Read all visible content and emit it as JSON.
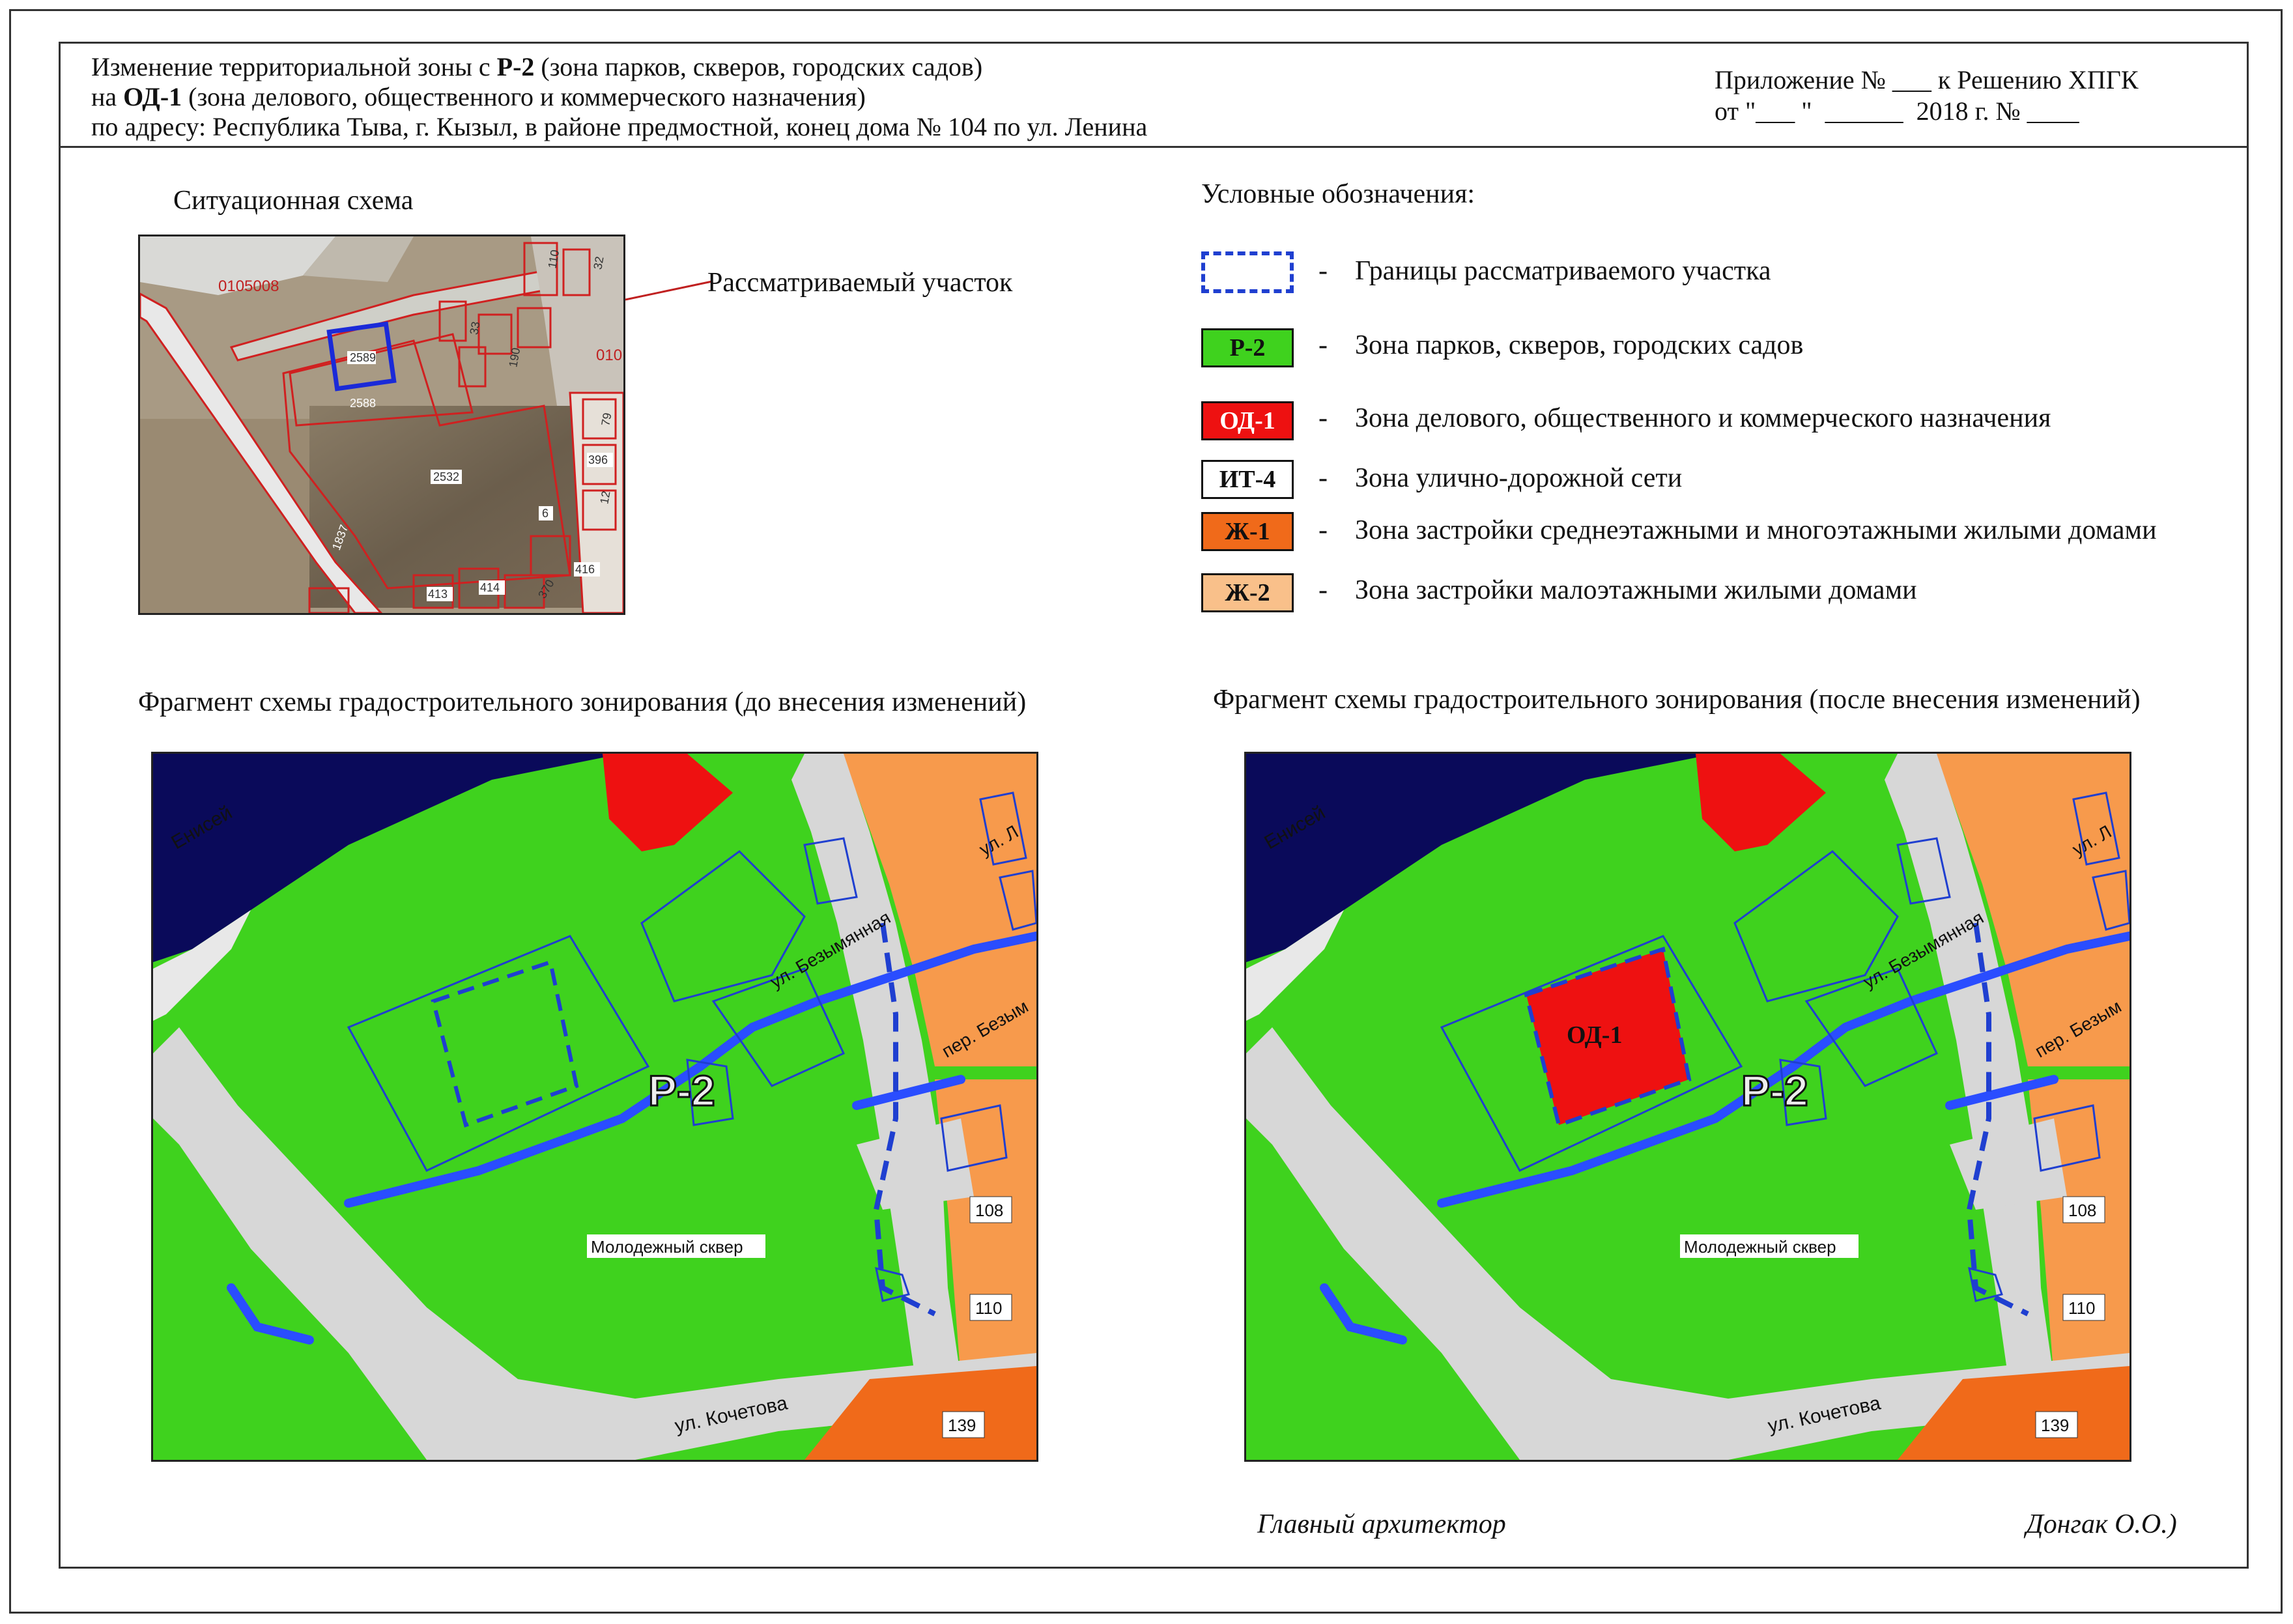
{
  "header": {
    "line1_pre": "Изменение территориальной зоны с ",
    "line1_bold": "Р-2",
    "line1_post": " (зона парков, скверов, городских садов)",
    "line2_pre": "на ",
    "line2_bold": "ОД-1",
    "line2_post": " (зона делового, общественного и коммерческого назначения)",
    "line3": "по адресу: Республика Тыва, г. Кызыл, в районе предмостной, конец дома № 104 по ул. Ленина",
    "appendix_line1": "Приложение № ___ к Решению ХПГК",
    "appendix_line2": "от \"___ \"  ______  2018 г. № ____"
  },
  "situation": {
    "title": "Ситуационная схема",
    "pointer_label": "Рассматриваемый участок",
    "labels": {
      "cadastral_block": "0105008",
      "block_short": "010",
      "p2589": "2589",
      "p2588": "2588",
      "p2532": "2532",
      "p1837": "1837",
      "p416": "416",
      "p413": "413",
      "p414": "414",
      "p396": "396",
      "p6": "6",
      "p110": "110",
      "p12": "12",
      "p370": "370",
      "p79": "79",
      "p33": "33",
      "p190": "190",
      "p32": "32"
    }
  },
  "legend": {
    "title": "Условные обозначения:",
    "dash": "-",
    "items": [
      {
        "code": "",
        "text": "Границы рассматриваемого участка"
      },
      {
        "code": "Р-2",
        "text": "Зона парков, скверов, городских садов"
      },
      {
        "code": "ОД-1",
        "text": "Зона делового, общественного и коммерческого назначения"
      },
      {
        "code": "ИТ-4",
        "text": "Зона улично-дорожной сети"
      },
      {
        "code": "Ж-1",
        "text": "Зона застройки среднеэтажными и многоэтажными жилыми домами"
      },
      {
        "code": "Ж-2",
        "text": "Зона застройки малоэтажными жилыми домами"
      }
    ]
  },
  "colors": {
    "park_green": "#3fd21e",
    "business_red": "#ee1111",
    "residential_orange": "#f79a4c",
    "road_grey": "#d7d7d7",
    "water_navy": "#0a0a5a",
    "boundary_blue": "#1f3fd0",
    "stream_blue": "#2a4dff",
    "mid_orange": "#f06a1a",
    "light_orange": "#f9c08a"
  },
  "maps": {
    "before_title": "Фрагмент схемы градостроительного зонирования (до внесения изменений)",
    "after_title": "Фрагмент схемы градостроительного зонирования (после внесения изменений)",
    "river": "Енисей",
    "street_bezymyannaya": "ул. Безымянная",
    "lane_bezymyanny": "пер. Безым",
    "street_ul": "ул. Л",
    "street_kochetova": "ул. Кочетова",
    "zone_label": "Р-2",
    "square_name": "Молодежный сквер",
    "h108": "108",
    "h110": "110",
    "h139": "139",
    "new_zone_label": "ОД-1"
  },
  "signature": {
    "position": "Главный архитектор",
    "name": "Донгак О.О.)"
  }
}
